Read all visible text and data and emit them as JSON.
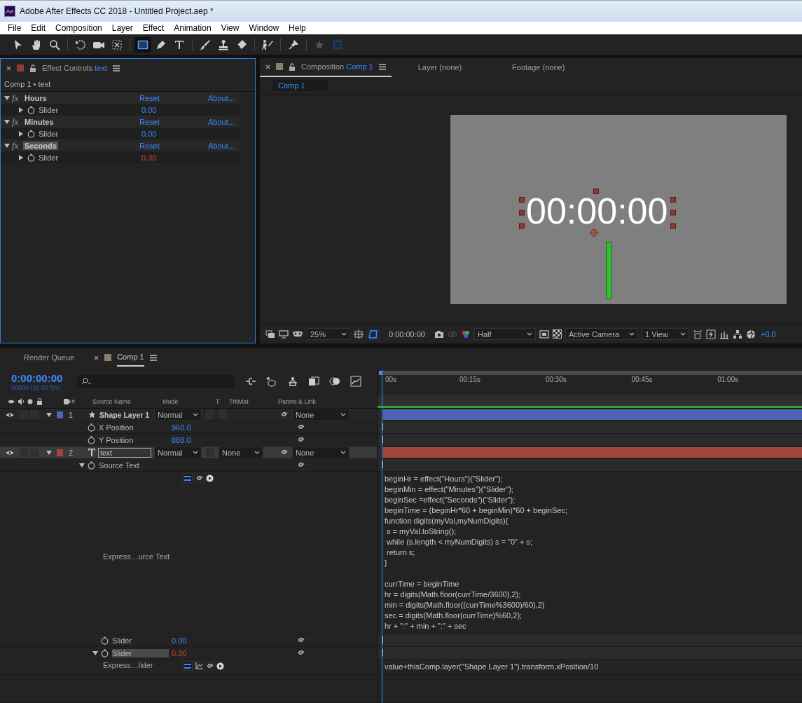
{
  "window": {
    "title": "Adobe After Effects CC 2018 - Untitled Project.aep *",
    "app_badge": "Ae"
  },
  "menu": [
    "File",
    "Edit",
    "Composition",
    "Layer",
    "Effect",
    "Animation",
    "View",
    "Window",
    "Help"
  ],
  "tools": [
    {
      "kind": "arrow",
      "selected": false
    },
    {
      "kind": "hand",
      "selected": false
    },
    {
      "kind": "zoom",
      "selected": false
    },
    {
      "kind": "rotate",
      "selected": false
    },
    {
      "kind": "camera",
      "selected": false
    },
    {
      "kind": "pan",
      "selected": false
    },
    {
      "kind": "rect",
      "selected": true
    },
    {
      "kind": "pen",
      "selected": false
    },
    {
      "kind": "type",
      "selected": false
    },
    {
      "kind": "brush",
      "selected": false
    },
    {
      "kind": "stamp",
      "selected": false
    },
    {
      "kind": "eraser",
      "selected": false
    },
    {
      "kind": "puppet",
      "selected": false
    },
    {
      "kind": "pin",
      "selected": false
    },
    {
      "kind": "star",
      "selected": false
    },
    {
      "kind": "grid",
      "selected": false
    }
  ],
  "effect_controls": {
    "tab_label": "Effect Controls",
    "layer": "text",
    "breadcrumb": "Comp 1 • text",
    "effects": [
      {
        "name": "Hours",
        "badge": "fx",
        "selected": false,
        "reset": "Reset",
        "about": "About...",
        "param": "Slider",
        "value": "0.00",
        "driven": false
      },
      {
        "name": "Minutes",
        "badge": "fx",
        "selected": false,
        "reset": "Reset",
        "about": "About...",
        "param": "Slider",
        "value": "0.00",
        "driven": false
      },
      {
        "name": "Seconds",
        "badge": "fx",
        "selected": true,
        "reset": "Reset",
        "about": "About...",
        "param": "Slider",
        "value": "0.30",
        "driven": true
      }
    ]
  },
  "composition": {
    "tab_label": "Composition",
    "comp": "Comp 1",
    "other_tabs": [
      "Layer (none)",
      "Footage (none)"
    ],
    "breadcrumb": "Comp 1",
    "display_text": "00:00:00",
    "bottom_bar": {
      "zoom": "25%",
      "timecode": "0:00:00:00",
      "resolution": "Half",
      "camera": "Active Camera",
      "views": "1 View",
      "exposure": "+0.0"
    }
  },
  "timeline": {
    "tabs": [
      {
        "label": "Render Queue",
        "selected": false
      },
      {
        "label": "Comp 1",
        "selected": true
      }
    ],
    "timecode": "0:00:00:00",
    "frames": "00000 (25.00 fps)",
    "columns": {
      "number": "#",
      "source_name": "Source Name",
      "mode": "Mode",
      "t": "T",
      "trkmat": "TrkMat",
      "parent": "Parent & Link"
    },
    "ruler": [
      "00s",
      "00:15s",
      "00:30s",
      "00:45s",
      "01:00s"
    ],
    "layers": [
      {
        "number": "1",
        "kind": "shape",
        "name": "Shape Layer 1",
        "color": "#4f63b0",
        "visible": true,
        "selected": false,
        "mode": "Normal",
        "parent": "None",
        "properties": [
          {
            "name": "X Position",
            "value": "960.0",
            "driven": false,
            "kind": "transform"
          },
          {
            "name": "Y Position",
            "value": "888.0",
            "driven": false,
            "kind": "transform"
          }
        ]
      },
      {
        "number": "2",
        "kind": "text",
        "name": "text",
        "color": "#a2443a",
        "visible": true,
        "selected": true,
        "mode": "Normal",
        "trkmat": "None",
        "parent": "None",
        "properties": [
          {
            "name": "Source Text",
            "kind": "transform",
            "expanded": true,
            "selected": false,
            "expression": {
              "label": "Express…urce Text",
              "graph": false,
              "code": "beginHr = effect(\"Hours\")(\"Slider\");\nbeginMin = effect(\"Minutes\")(\"Slider\");\nbeginSec =effect(\"Seconds\")(\"Slider\");\nbeginTime = (beginHr*60 + beginMin)*60 + beginSec;\nfunction digits(myVal,myNumDigits){\n s = myVal.toString();\n while (s.length < myNumDigits) s = \"0\" + s;\n return s;\n}\n\ncurrTime = beginTime\nhr = digits(Math.floor(currTime/3600),2);\nmin = digits(Math.floor((currTime%3600)/60),2)\nsec = digits(Math.floor(currTime)%60,2);\nhr + \":\" + min + \":\" + sec"
            }
          },
          {
            "name": "Slider",
            "value": "0.00",
            "driven": false,
            "kind": "effect_param"
          },
          {
            "name": "Slider",
            "value": "0.30",
            "driven": true,
            "kind": "effect_param",
            "expanded": true,
            "selected": true,
            "expression": {
              "label": "Express…lider",
              "graph": true,
              "code": "value+thisComp.layer(\"Shape Layer 1\").transform.xPosition/10"
            }
          }
        ]
      }
    ]
  }
}
